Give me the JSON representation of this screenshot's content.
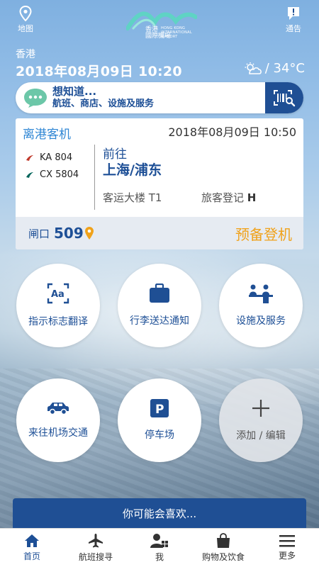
{
  "header": {
    "map_label": "地图",
    "notice_label": "通告",
    "logo": {
      "zh": "香港\n國際機場",
      "en": "HONG KONG\nINTERNATIONAL\nAIRPORT"
    }
  },
  "location": {
    "city": "香港",
    "datetime": "2018年08月09日 10:20",
    "weather_icon": "partly-cloudy-icon",
    "temperature": "/ 34°C"
  },
  "search": {
    "title": "想知道...",
    "subtitle": "航班、商店、设施及服务"
  },
  "flight_card": {
    "type": "离港客机",
    "datetime": "2018年08月09日 10:50",
    "flights": [
      {
        "number": "KA 804",
        "airline_color": "#00645a"
      },
      {
        "number": "CX 5804",
        "airline_color": "#00645a"
      }
    ],
    "to_label": "前往",
    "destination": "上海/浦东",
    "terminal": "客运大楼 T1",
    "checkin_label": "旅客登记",
    "checkin_row": "H",
    "gate_label": "闸口",
    "gate_number": "509",
    "status": "预备登机"
  },
  "quick_actions": [
    {
      "label": "指示标志翻译",
      "icon": "translate-icon"
    },
    {
      "label": "行李送达通知",
      "icon": "luggage-icon"
    },
    {
      "label": "设施及服务",
      "icon": "service-counter-icon"
    },
    {
      "label": "来往机场交通",
      "icon": "car-icon"
    },
    {
      "label": "停车场",
      "icon": "parking-icon"
    },
    {
      "label": "添加 / 编辑",
      "icon": "plus-icon"
    }
  ],
  "recommend": {
    "label": "你可能会喜欢..."
  },
  "bottom_nav": [
    {
      "label": "首页",
      "icon": "home-icon",
      "active": true
    },
    {
      "label": "航班搜寻",
      "icon": "airplane-icon"
    },
    {
      "label": "我",
      "icon": "profile-qr-icon"
    },
    {
      "label": "购物及饮食",
      "icon": "shopping-bag-icon"
    },
    {
      "label": "更多",
      "icon": "menu-icon"
    }
  ],
  "colors": {
    "brand_blue": "#1f4f94",
    "accent_orange": "#f0a21b",
    "link_blue": "#2f86d4"
  }
}
